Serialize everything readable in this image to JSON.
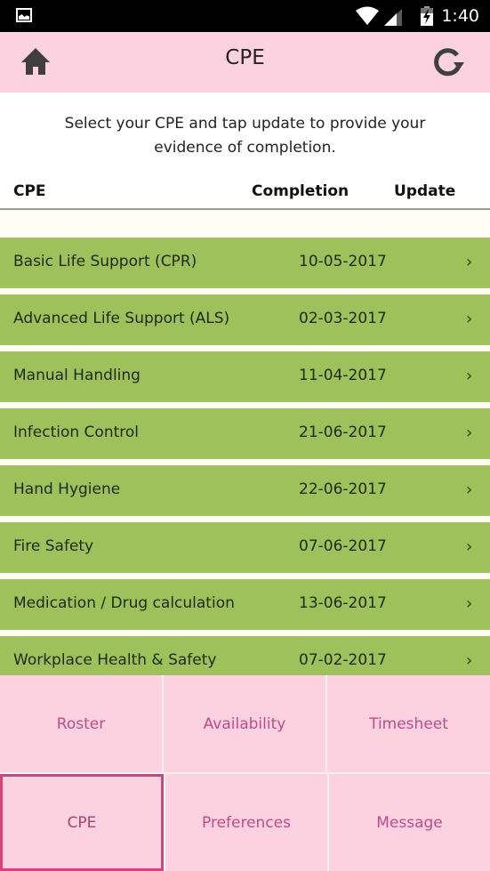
{
  "status_bar": {
    "time": "1:40",
    "icons": [
      "gallery-icon",
      "wifi-icon",
      "cell-signal-icon",
      "battery-charging-icon"
    ]
  },
  "app_bar": {
    "title": "CPE",
    "left_icon": "home-icon",
    "right_icon": "refresh-icon"
  },
  "instructions": {
    "line1": "Select your CPE and tap update to provide your",
    "line2": "evidence of completion."
  },
  "table": {
    "headers": {
      "cpe": "CPE",
      "completion": "Completion",
      "update": "Update"
    },
    "rows": [
      {
        "name": "Basic Life Support (CPR)",
        "completion": "10-05-2017",
        "chevron": "›"
      },
      {
        "name": "Advanced Life Support (ALS)",
        "completion": "02-03-2017",
        "chevron": "›"
      },
      {
        "name": "Manual Handling",
        "completion": "11-04-2017",
        "chevron": "›"
      },
      {
        "name": "Infection Control",
        "completion": "21-06-2017",
        "chevron": "›"
      },
      {
        "name": "Hand Hygiene",
        "completion": "22-06-2017",
        "chevron": "›"
      },
      {
        "name": "Fire Safety",
        "completion": "07-06-2017",
        "chevron": "›"
      },
      {
        "name": "Medication / Drug calculation",
        "completion": "13-06-2017",
        "chevron": "›"
      },
      {
        "name": "Workplace Health & Safety",
        "completion": "07-02-2017",
        "chevron": "›"
      }
    ]
  },
  "nav": {
    "items": [
      {
        "label": "Roster",
        "active": false
      },
      {
        "label": "Availability",
        "active": false
      },
      {
        "label": "Timesheet",
        "active": false
      },
      {
        "label": "CPE",
        "active": true
      },
      {
        "label": "Preferences",
        "active": false
      },
      {
        "label": "Message",
        "active": false
      }
    ]
  },
  "colors": {
    "app_bar_bg": "#fcd2e1",
    "row_bg": "#9fc15c",
    "nav_text": "#c04b8a",
    "active_border": "#d8417a"
  }
}
